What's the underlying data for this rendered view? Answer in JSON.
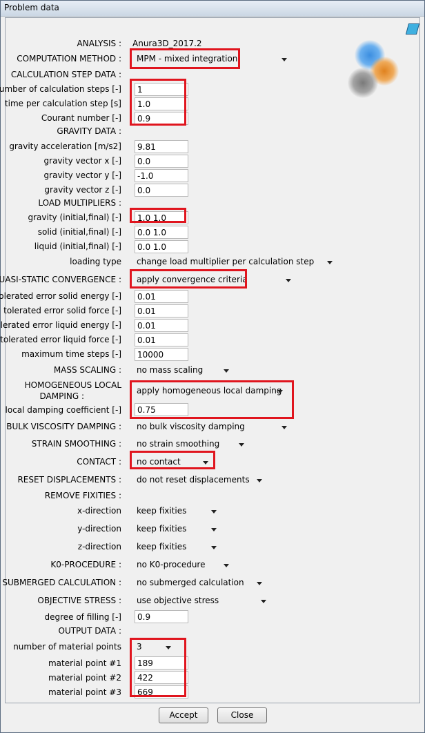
{
  "window": {
    "title": "Problem data"
  },
  "analysis": {
    "label": "ANALYSIS :",
    "value": "Anura3D_2017.2"
  },
  "computation_method": {
    "label": "COMPUTATION METHOD :",
    "value": "MPM - mixed integration"
  },
  "calc_step": {
    "header": "CALCULATION STEP DATA :",
    "fields": [
      {
        "label": "number of calculation steps [-]",
        "value": "1"
      },
      {
        "label": "time per calculation step [s]",
        "value": "1.0"
      },
      {
        "label": "Courant number [-]",
        "value": "0.9"
      }
    ]
  },
  "gravity": {
    "header": "GRAVITY DATA :",
    "fields": [
      {
        "label": "gravity acceleration [m/s2]",
        "value": "9.81"
      },
      {
        "label": "gravity vector x [-]",
        "value": "0.0"
      },
      {
        "label": "gravity vector y [-]",
        "value": "-1.0"
      },
      {
        "label": "gravity vector z [-]",
        "value": "0.0"
      }
    ]
  },
  "load": {
    "header": "LOAD MULTIPLIERS :",
    "fields": [
      {
        "label": "gravity (initial,final) [-]",
        "value": "1.0  1.0"
      },
      {
        "label": "solid (initial,final) [-]",
        "value": "0.0  1.0"
      },
      {
        "label": "liquid (initial,final) [-]",
        "value": "0.0  1.0"
      }
    ],
    "loading_type_label": "loading type",
    "loading_type_value": "change load multiplier per calculation step"
  },
  "quasi": {
    "label": "QUASI-STATIC CONVERGENCE :",
    "value": "apply convergence criteria",
    "fields": [
      {
        "label": "tolerated error solid energy [-]",
        "value": "0.01"
      },
      {
        "label": "tolerated error solid force [-]",
        "value": "0.01"
      },
      {
        "label": "tolerated error liquid energy [-]",
        "value": "0.01"
      },
      {
        "label": "tolerated error liquid force [-]",
        "value": "0.01"
      },
      {
        "label": "maximum time steps [-]",
        "value": "10000"
      }
    ]
  },
  "mass_scaling": {
    "label": "MASS SCALING :",
    "value": "no mass scaling"
  },
  "damping": {
    "label1": "HOMOGENEOUS LOCAL",
    "label2": "DAMPING :",
    "value": "apply homogeneous local damping",
    "coef_label": "local damping coefficient [-]",
    "coef_value": "0.75"
  },
  "bulk": {
    "label": "BULK VISCOSITY DAMPING :",
    "value": "no bulk viscosity damping"
  },
  "strain": {
    "label": "STRAIN SMOOTHING :",
    "value": "no strain smoothing"
  },
  "contact": {
    "label": "CONTACT :",
    "value": "no contact"
  },
  "reset": {
    "label": "RESET DISPLACEMENTS :",
    "value": "do not reset displacements"
  },
  "fixities": {
    "header": "REMOVE FIXITIES :",
    "rows": [
      {
        "label": "x-direction",
        "value": "keep fixities"
      },
      {
        "label": "y-direction",
        "value": "keep fixities"
      },
      {
        "label": "z-direction",
        "value": "keep fixities"
      }
    ]
  },
  "k0": {
    "label": "K0-PROCEDURE :",
    "value": "no K0-procedure"
  },
  "submerged": {
    "label": "SUBMERGED CALCULATION :",
    "value": "no submerged calculation"
  },
  "objective": {
    "label": "OBJECTIVE STRESS :",
    "value": "use objective stress"
  },
  "filling": {
    "label": "degree of filling [-]",
    "value": "0.9"
  },
  "output": {
    "header": "OUTPUT DATA :",
    "num_label": "number of material points",
    "num_value": "3",
    "points": [
      {
        "label": "material point #1",
        "value": "189"
      },
      {
        "label": "material point #2",
        "value": "422"
      },
      {
        "label": "material point #3",
        "value": "669"
      }
    ]
  },
  "buttons": {
    "accept": "Accept",
    "close": "Close"
  },
  "colors": {
    "highlight": "#e0151e"
  }
}
